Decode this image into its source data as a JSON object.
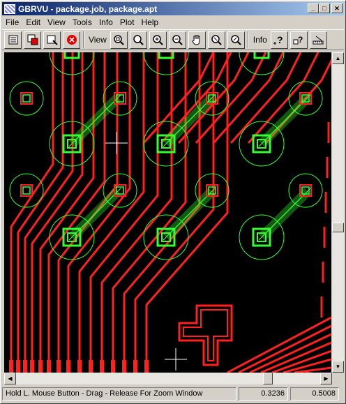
{
  "window": {
    "title": "GBRVU - package.job, package.apt",
    "minimize": "_",
    "maximize": "□",
    "close": "✕"
  },
  "menu": [
    "File",
    "Edit",
    "View",
    "Tools",
    "Info",
    "Plot",
    "Help"
  ],
  "toolbar": {
    "view_label": "View",
    "info_label": "Info",
    "tools": [
      {
        "icon": "layers-icon"
      },
      {
        "icon": "layer-color-icon"
      },
      {
        "icon": "open-file-icon"
      },
      {
        "icon": "stop-icon"
      },
      {
        "icon": "zoom-fit-icon"
      },
      {
        "icon": "zoom-window-icon"
      },
      {
        "icon": "zoom-in-icon"
      },
      {
        "icon": "zoom-out-icon"
      },
      {
        "icon": "pan-hand-icon"
      },
      {
        "icon": "zoom-previous-icon"
      },
      {
        "icon": "zoom-redraw-icon"
      },
      {
        "icon": "info-query-icon"
      },
      {
        "icon": "info-object-icon"
      },
      {
        "icon": "measure-icon"
      }
    ]
  },
  "status": {
    "message": "Hold L. Mouse Button - Drag - Release For Zoom Window",
    "x": "0.3236",
    "y": "0.5008"
  },
  "colors": {
    "trace": "#ff2020",
    "pad": "#33ff33",
    "background": "#000000"
  }
}
